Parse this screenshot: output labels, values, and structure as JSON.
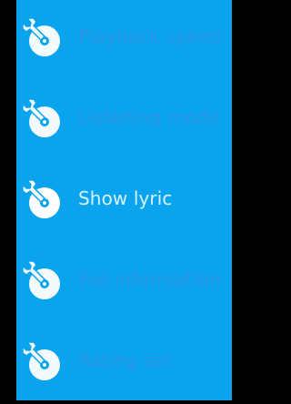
{
  "menu": {
    "items": [
      {
        "label": "Playback speed",
        "icon": "disc-wrench-icon",
        "selected": false
      },
      {
        "label": "Listening mode",
        "icon": "disc-wrench-icon",
        "selected": false
      },
      {
        "label": "Show lyric",
        "icon": "disc-wrench-icon",
        "selected": true
      },
      {
        "label": "File information",
        "icon": "disc-wrench-icon",
        "selected": false
      },
      {
        "label": "Rating set",
        "icon": "disc-wrench-icon",
        "selected": false
      }
    ]
  },
  "colors": {
    "background": "#0aa4ee",
    "label_dim": "#2b96e6",
    "label_selected": "#d6f3ff",
    "icon_fill": "#ffffff"
  }
}
